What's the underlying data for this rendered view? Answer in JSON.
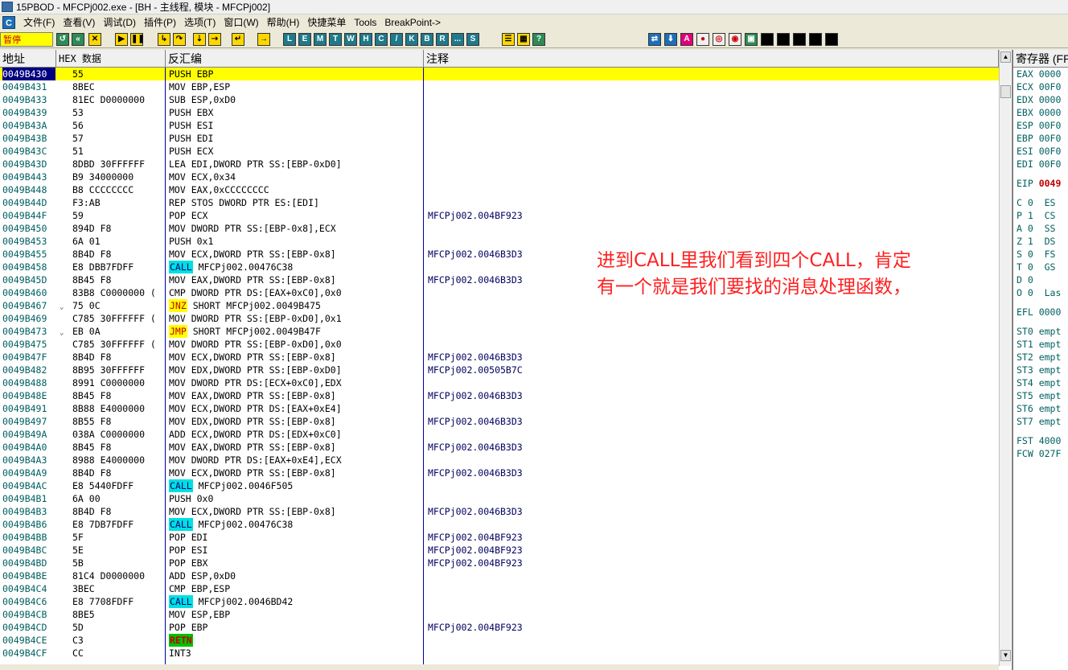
{
  "window": {
    "title": "15PBOD - MFCPj002.exe - [BH - 主线程, 模块 - MFCPj002]"
  },
  "menu": [
    "文件(F)",
    "查看(V)",
    "调试(D)",
    "插件(P)",
    "选项(T)",
    "窗口(W)",
    "帮助(H)",
    "快捷菜单",
    "Tools",
    "BreakPoint->"
  ],
  "right_buttons": [
    "BP",
    "P",
    "VB",
    "记事本",
    "计算器",
    "资源管理器",
    "CMD命令",
    "退出"
  ],
  "status": "暂停",
  "toolbar_letters": [
    "L",
    "E",
    "M",
    "T",
    "W",
    "H",
    "C",
    "/",
    "K",
    "B",
    "R",
    "...",
    "S"
  ],
  "headers": {
    "addr": "地址",
    "hex": "HEX 数据",
    "dis": "反汇编",
    "cmt": "注释",
    "regs": "寄存器 (FPU)"
  },
  "rows": [
    {
      "addr": "0049B430",
      "hex": "55",
      "pre": "",
      "kw": "",
      "dis": "PUSH EBP",
      "cmt": "",
      "cur": true
    },
    {
      "addr": "0049B431",
      "hex": "8BEC",
      "pre": "",
      "kw": "",
      "dis": "MOV EBP,ESP",
      "cmt": ""
    },
    {
      "addr": "0049B433",
      "hex": "81EC D0000000",
      "pre": "",
      "kw": "",
      "dis": "SUB ESP,0xD0",
      "cmt": ""
    },
    {
      "addr": "0049B439",
      "hex": "53",
      "pre": "",
      "kw": "",
      "dis": "PUSH EBX",
      "cmt": ""
    },
    {
      "addr": "0049B43A",
      "hex": "56",
      "pre": "",
      "kw": "",
      "dis": "PUSH ESI",
      "cmt": ""
    },
    {
      "addr": "0049B43B",
      "hex": "57",
      "pre": "",
      "kw": "",
      "dis": "PUSH EDI",
      "cmt": ""
    },
    {
      "addr": "0049B43C",
      "hex": "51",
      "pre": "",
      "kw": "",
      "dis": "PUSH ECX",
      "cmt": ""
    },
    {
      "addr": "0049B43D",
      "hex": "8DBD 30FFFFFF",
      "pre": "",
      "kw": "",
      "dis": "LEA EDI,DWORD PTR SS:[EBP-0xD0]",
      "cmt": ""
    },
    {
      "addr": "0049B443",
      "hex": "B9 34000000",
      "pre": "",
      "kw": "",
      "dis": "MOV ECX,0x34",
      "cmt": ""
    },
    {
      "addr": "0049B448",
      "hex": "B8 CCCCCCCC",
      "pre": "",
      "kw": "",
      "dis": "MOV EAX,0xCCCCCCCC",
      "cmt": ""
    },
    {
      "addr": "0049B44D",
      "hex": "F3:AB",
      "pre": "",
      "kw": "",
      "dis": "REP STOS DWORD PTR ES:[EDI]",
      "cmt": ""
    },
    {
      "addr": "0049B44F",
      "hex": "59",
      "pre": "",
      "kw": "",
      "dis": "POP ECX",
      "cmt": "MFCPj002.004BF923"
    },
    {
      "addr": "0049B450",
      "hex": "894D F8",
      "pre": "",
      "kw": "",
      "dis": "MOV DWORD PTR SS:[EBP-0x8],ECX",
      "cmt": ""
    },
    {
      "addr": "0049B453",
      "hex": "6A 01",
      "pre": "",
      "kw": "",
      "dis": "PUSH 0x1",
      "cmt": ""
    },
    {
      "addr": "0049B455",
      "hex": "8B4D F8",
      "pre": "",
      "kw": "",
      "dis": "MOV ECX,DWORD PTR SS:[EBP-0x8]",
      "cmt": "MFCPj002.0046B3D3"
    },
    {
      "addr": "0049B458",
      "hex": "E8 DBB7FDFF",
      "pre": "",
      "kw": "CALL",
      "kwc": "call",
      "dis": " MFCPj002.00476C38",
      "cmt": ""
    },
    {
      "addr": "0049B45D",
      "hex": "8B45 F8",
      "pre": "",
      "kw": "",
      "dis": "MOV EAX,DWORD PTR SS:[EBP-0x8]",
      "cmt": "MFCPj002.0046B3D3"
    },
    {
      "addr": "0049B460",
      "hex": "83B8 C0000000 (",
      "pre": "",
      "kw": "",
      "dis": "CMP DWORD PTR DS:[EAX+0xC0],0x0",
      "cmt": ""
    },
    {
      "addr": "0049B467",
      "hex": "75 0C",
      "pre": "⌄",
      "kw": "JNZ",
      "kwc": "jnz",
      "dis": " SHORT MFCPj002.0049B475",
      "cmt": ""
    },
    {
      "addr": "0049B469",
      "hex": "C785 30FFFFFF (",
      "pre": "",
      "kw": "",
      "dis": "MOV DWORD PTR SS:[EBP-0xD0],0x1",
      "cmt": ""
    },
    {
      "addr": "0049B473",
      "hex": "EB 0A",
      "pre": "⌄",
      "kw": "JMP",
      "kwc": "jmp",
      "dis": " SHORT MFCPj002.0049B47F",
      "cmt": ""
    },
    {
      "addr": "0049B475",
      "hex": "C785 30FFFFFF (",
      "pre": "",
      "kw": "",
      "dis": "MOV DWORD PTR SS:[EBP-0xD0],0x0",
      "cmt": ""
    },
    {
      "addr": "0049B47F",
      "hex": "8B4D F8",
      "pre": "",
      "kw": "",
      "dis": "MOV ECX,DWORD PTR SS:[EBP-0x8]",
      "cmt": "MFCPj002.0046B3D3"
    },
    {
      "addr": "0049B482",
      "hex": "8B95 30FFFFFF",
      "pre": "",
      "kw": "",
      "dis": "MOV EDX,DWORD PTR SS:[EBP-0xD0]",
      "cmt": "MFCPj002.00505B7C"
    },
    {
      "addr": "0049B488",
      "hex": "8991 C0000000",
      "pre": "",
      "kw": "",
      "dis": "MOV DWORD PTR DS:[ECX+0xC0],EDX",
      "cmt": ""
    },
    {
      "addr": "0049B48E",
      "hex": "8B45 F8",
      "pre": "",
      "kw": "",
      "dis": "MOV EAX,DWORD PTR SS:[EBP-0x8]",
      "cmt": "MFCPj002.0046B3D3"
    },
    {
      "addr": "0049B491",
      "hex": "8B88 E4000000",
      "pre": "",
      "kw": "",
      "dis": "MOV ECX,DWORD PTR DS:[EAX+0xE4]",
      "cmt": ""
    },
    {
      "addr": "0049B497",
      "hex": "8B55 F8",
      "pre": "",
      "kw": "",
      "dis": "MOV EDX,DWORD PTR SS:[EBP-0x8]",
      "cmt": "MFCPj002.0046B3D3"
    },
    {
      "addr": "0049B49A",
      "hex": "038A C0000000",
      "pre": "",
      "kw": "",
      "dis": "ADD ECX,DWORD PTR DS:[EDX+0xC0]",
      "cmt": ""
    },
    {
      "addr": "0049B4A0",
      "hex": "8B45 F8",
      "pre": "",
      "kw": "",
      "dis": "MOV EAX,DWORD PTR SS:[EBP-0x8]",
      "cmt": "MFCPj002.0046B3D3"
    },
    {
      "addr": "0049B4A3",
      "hex": "8988 E4000000",
      "pre": "",
      "kw": "",
      "dis": "MOV DWORD PTR DS:[EAX+0xE4],ECX",
      "cmt": ""
    },
    {
      "addr": "0049B4A9",
      "hex": "8B4D F8",
      "pre": "",
      "kw": "",
      "dis": "MOV ECX,DWORD PTR SS:[EBP-0x8]",
      "cmt": "MFCPj002.0046B3D3"
    },
    {
      "addr": "0049B4AC",
      "hex": "E8 5440FDFF",
      "pre": "",
      "kw": "CALL",
      "kwc": "call",
      "dis": " MFCPj002.0046F505",
      "cmt": ""
    },
    {
      "addr": "0049B4B1",
      "hex": "6A 00",
      "pre": "",
      "kw": "",
      "dis": "PUSH 0x0",
      "cmt": ""
    },
    {
      "addr": "0049B4B3",
      "hex": "8B4D F8",
      "pre": "",
      "kw": "",
      "dis": "MOV ECX,DWORD PTR SS:[EBP-0x8]",
      "cmt": "MFCPj002.0046B3D3"
    },
    {
      "addr": "0049B4B6",
      "hex": "E8 7DB7FDFF",
      "pre": "",
      "kw": "CALL",
      "kwc": "call",
      "dis": " MFCPj002.00476C38",
      "cmt": ""
    },
    {
      "addr": "0049B4BB",
      "hex": "5F",
      "pre": "",
      "kw": "",
      "dis": "POP EDI",
      "cmt": "MFCPj002.004BF923"
    },
    {
      "addr": "0049B4BC",
      "hex": "5E",
      "pre": "",
      "kw": "",
      "dis": "POP ESI",
      "cmt": "MFCPj002.004BF923"
    },
    {
      "addr": "0049B4BD",
      "hex": "5B",
      "pre": "",
      "kw": "",
      "dis": "POP EBX",
      "cmt": "MFCPj002.004BF923"
    },
    {
      "addr": "0049B4BE",
      "hex": "81C4 D0000000",
      "pre": "",
      "kw": "",
      "dis": "ADD ESP,0xD0",
      "cmt": ""
    },
    {
      "addr": "0049B4C4",
      "hex": "3BEC",
      "pre": "",
      "kw": "",
      "dis": "CMP EBP,ESP",
      "cmt": ""
    },
    {
      "addr": "0049B4C6",
      "hex": "E8 7708FDFF",
      "pre": "",
      "kw": "CALL",
      "kwc": "call",
      "dis": " MFCPj002.0046BD42",
      "cmt": ""
    },
    {
      "addr": "0049B4CB",
      "hex": "8BE5",
      "pre": "",
      "kw": "",
      "dis": "MOV ESP,EBP",
      "cmt": ""
    },
    {
      "addr": "0049B4CD",
      "hex": "5D",
      "pre": "",
      "kw": "",
      "dis": "POP EBP",
      "cmt": "MFCPj002.004BF923"
    },
    {
      "addr": "0049B4CE",
      "hex": "C3",
      "pre": "",
      "kw": "RETN",
      "kwc": "retn",
      "dis": "",
      "cmt": ""
    },
    {
      "addr": "0049B4CF",
      "hex": "CC",
      "pre": "",
      "kw": "",
      "dis": "INT3",
      "cmt": ""
    }
  ],
  "registers": [
    {
      "t": "EAX 0000"
    },
    {
      "t": "ECX 00F0"
    },
    {
      "t": "EDX 0000"
    },
    {
      "t": "EBX 0000"
    },
    {
      "t": "ESP 00F0"
    },
    {
      "t": "EBP 00F0"
    },
    {
      "t": "ESI 00F0"
    },
    {
      "t": "EDI 00F0"
    },
    {
      "t": "",
      "gap": true
    },
    {
      "t": "EIP ",
      "v": "0049",
      "eip": true
    },
    {
      "t": "",
      "gap": true
    },
    {
      "t": "C 0  ES"
    },
    {
      "t": "P 1  CS"
    },
    {
      "t": "A 0  SS"
    },
    {
      "t": "Z 1  DS"
    },
    {
      "t": "S 0  FS"
    },
    {
      "t": "T 0  GS"
    },
    {
      "t": "D 0"
    },
    {
      "t": "O 0  Las"
    },
    {
      "t": "",
      "gap": true
    },
    {
      "t": "EFL 0000"
    },
    {
      "t": "",
      "gap": true
    },
    {
      "t": "ST0 empt"
    },
    {
      "t": "ST1 empt"
    },
    {
      "t": "ST2 empt"
    },
    {
      "t": "ST3 empt"
    },
    {
      "t": "ST4 empt"
    },
    {
      "t": "ST5 empt"
    },
    {
      "t": "ST6 empt"
    },
    {
      "t": "ST7 empt"
    },
    {
      "t": "",
      "gap": true
    },
    {
      "t": "FST 4000"
    },
    {
      "t": "FCW 027F"
    }
  ],
  "annotation": "进到CALL里我们看到四个CALL，肯定\n有一个就是我们要找的消息处理函数，"
}
